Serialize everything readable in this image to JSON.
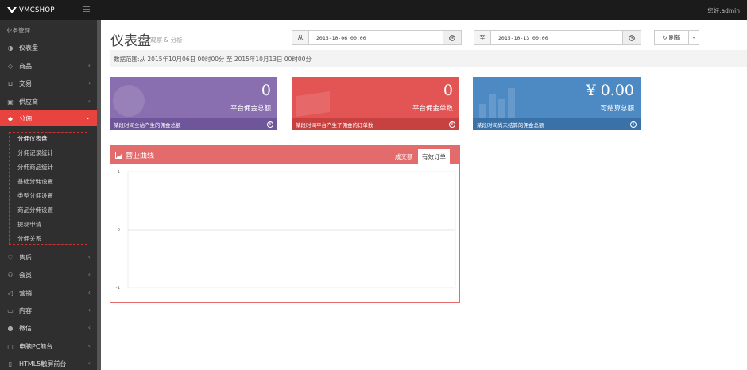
{
  "header": {
    "logo_text": "VMCSHOP",
    "user_text": "您好,admin"
  },
  "sidebar": {
    "section_title": "业务管理",
    "items": [
      {
        "label": "仪表盘",
        "icon": "dashboard-icon",
        "chevron": false
      },
      {
        "label": "商品",
        "icon": "diamond-icon",
        "chevron": true
      },
      {
        "label": "交易",
        "icon": "cart-icon",
        "chevron": true
      },
      {
        "label": "供应商",
        "icon": "mug-icon",
        "chevron": true
      },
      {
        "label": "分佣",
        "icon": "diamond-icon",
        "chevron": true,
        "active": true
      },
      {
        "label": "售后",
        "icon": "heart-icon",
        "chevron": true
      },
      {
        "label": "会员",
        "icon": "user-icon",
        "chevron": true
      },
      {
        "label": "营销",
        "icon": "bullhorn-icon",
        "chevron": true
      },
      {
        "label": "内容",
        "icon": "folder-icon",
        "chevron": true
      },
      {
        "label": "微信",
        "icon": "wechat-icon",
        "chevron": true
      },
      {
        "label": "电脑PC前台",
        "icon": "desktop-icon",
        "chevron": true
      },
      {
        "label": "HTML5触屏前台",
        "icon": "mobile-icon",
        "chevron": true
      }
    ],
    "submenu": [
      "分佣仪表盘",
      "分佣记录统计",
      "分佣商品统计",
      "基础分佣设置",
      "类型分佣设置",
      "商品分佣设置",
      "提现申请",
      "分佣关系"
    ]
  },
  "main": {
    "title": "仪表盘",
    "subtitle": "观察 & 分析",
    "from_label": "从",
    "from_value": "2015-10-06 00:00",
    "to_label": "至",
    "to_value": "2015-10-13 00:00",
    "refresh_label": "刷新",
    "range_text": "数据范围:从 2015年10月06日 00时00分 至 2015年10月13日 00时00分"
  },
  "cards": [
    {
      "value": "0",
      "label": "平台佣金总额",
      "footer": "某段时间全站产生的佣金总额",
      "color": "#8a6fb0",
      "footer_color": "#6f5599"
    },
    {
      "value": "0",
      "label": "平台佣金单数",
      "footer": "某段时间平台产生了佣金的订单数",
      "color": "#e35454",
      "footer_color": "#c74141"
    },
    {
      "value": "¥ 0.00",
      "label": "可结算总额",
      "footer": "某段时间尚未结算的佣金总额",
      "color": "#4d8ac4",
      "footer_color": "#3a72a8"
    }
  ],
  "chart_panel": {
    "title": "营业曲线",
    "tabs": [
      "成交额",
      "有效订单"
    ],
    "active_tab": "有效订单",
    "accent": "#e46b6b"
  },
  "chart_data": {
    "type": "line",
    "title": "",
    "xlabel": "",
    "ylabel": "",
    "ylim": [
      -1,
      1
    ],
    "yticks": [
      "1",
      "0",
      "-1"
    ],
    "series": []
  }
}
